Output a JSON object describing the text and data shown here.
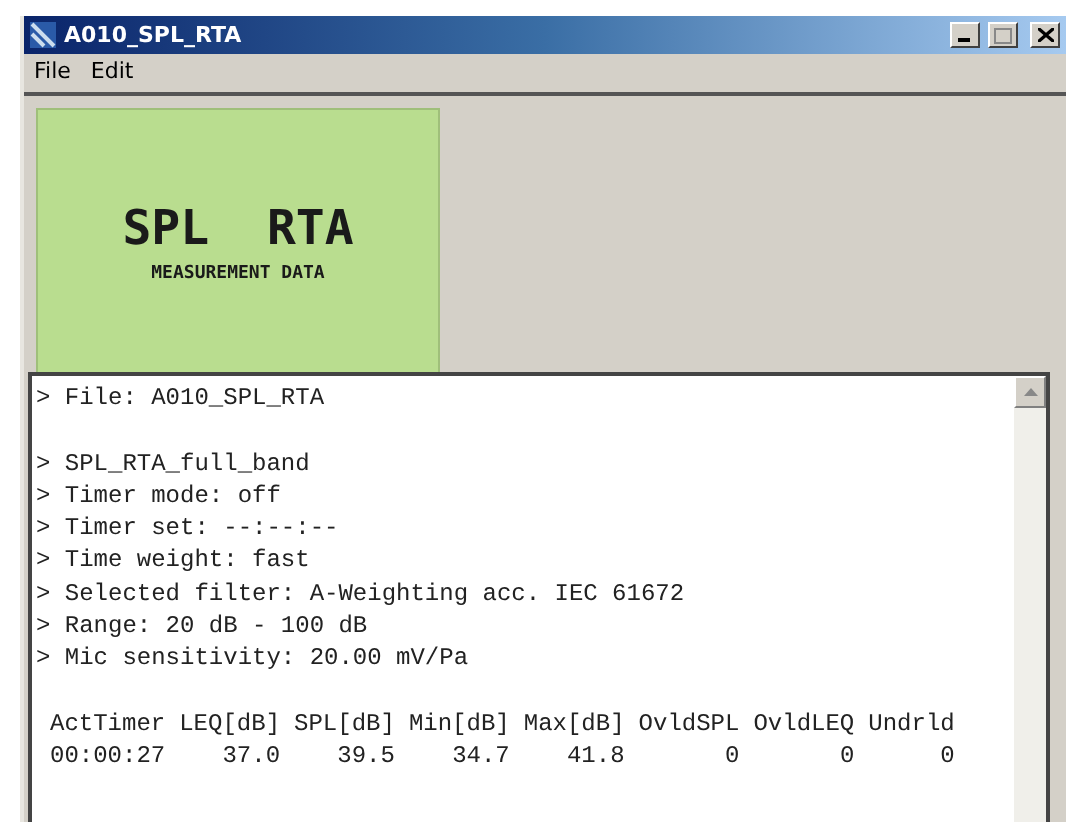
{
  "window": {
    "title": "A010_SPL_RTA"
  },
  "menu": [
    {
      "label": "File"
    },
    {
      "label": "Edit"
    }
  ],
  "banner": {
    "title": "SPL  RTA",
    "subtitle": "MEASUREMENT DATA"
  },
  "log": {
    "lines": [
      {
        "kind": "line",
        "text": "> File: A010_SPL_RTA"
      },
      {
        "kind": "blank"
      },
      {
        "kind": "line",
        "text": "> SPL_RTA_full_band"
      },
      {
        "kind": "line",
        "text": "> Timer mode: off"
      },
      {
        "kind": "line",
        "text": "> Timer set: --:--:--"
      },
      {
        "kind": "line",
        "text": "> Time weight: fast"
      },
      {
        "kind": "line",
        "text": "> Selected filter: A-Weighting acc. IEC 61672"
      },
      {
        "kind": "line",
        "text": "> Range: 20 dB - 100 dB"
      },
      {
        "kind": "line",
        "text": "> Mic sensitivity: 20.00 mV/Pa"
      },
      {
        "kind": "blank"
      }
    ],
    "table": {
      "columns": [
        "ActTimer",
        "LEQ[dB]",
        "SPL[dB]",
        "Min[dB]",
        "Max[dB]",
        "OvldSPL",
        "OvldLEQ",
        "Undrld"
      ],
      "rows": [
        [
          "00:00:27",
          "37.0",
          "39.5",
          "34.7",
          "41.8",
          "0",
          "0",
          "0"
        ]
      ]
    }
  }
}
